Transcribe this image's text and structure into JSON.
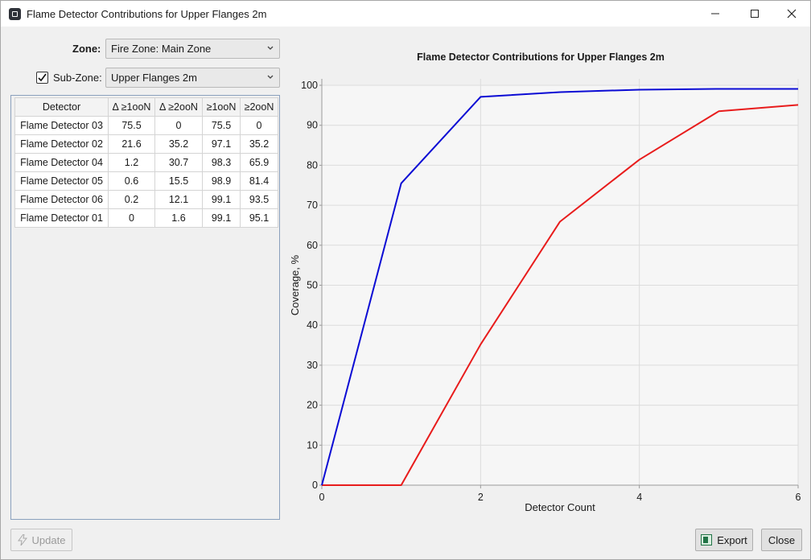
{
  "window": {
    "title": "Flame Detector Contributions for Upper Flanges 2m"
  },
  "zone": {
    "label": "Zone:",
    "value": "Fire Zone: Main Zone"
  },
  "subzone": {
    "label": "Sub-Zone:",
    "checked": true,
    "value": "Upper Flanges 2m"
  },
  "table": {
    "headers": [
      "Detector",
      "Δ ≥1ooN",
      "Δ ≥2ooN",
      "≥1ooN",
      "≥2ooN"
    ],
    "rows": [
      [
        "Flame Detector 03",
        "75.5",
        "0",
        "75.5",
        "0"
      ],
      [
        "Flame Detector 02",
        "21.6",
        "35.2",
        "97.1",
        "35.2"
      ],
      [
        "Flame Detector 04",
        "1.2",
        "30.7",
        "98.3",
        "65.9"
      ],
      [
        "Flame Detector 05",
        "0.6",
        "15.5",
        "98.9",
        "81.4"
      ],
      [
        "Flame Detector 06",
        "0.2",
        "12.1",
        "99.1",
        "93.5"
      ],
      [
        "Flame Detector 01",
        "0",
        "1.6",
        "99.1",
        "95.1"
      ]
    ]
  },
  "buttons": {
    "update": "Update",
    "export": "Export",
    "close": "Close"
  },
  "chart_data": {
    "type": "line",
    "title": "Flame Detector Contributions for Upper Flanges 2m",
    "xlabel": "Detector Count",
    "ylabel": "Coverage, %",
    "xlim": [
      0,
      6
    ],
    "ylim": [
      0,
      100
    ],
    "xticks": [
      0,
      2,
      4,
      6
    ],
    "yticks": [
      0,
      10,
      20,
      30,
      40,
      50,
      60,
      70,
      80,
      90,
      100
    ],
    "grid": true,
    "x": [
      0,
      1,
      2,
      3,
      4,
      5,
      6
    ],
    "series": [
      {
        "values": [
          0,
          75.5,
          97.1,
          98.3,
          98.9,
          99.1,
          99.1
        ],
        "color": "#0b0bd4"
      },
      {
        "values": [
          0,
          0,
          35.2,
          65.9,
          81.4,
          93.5,
          95.1
        ],
        "color": "#e81c1c"
      }
    ]
  }
}
